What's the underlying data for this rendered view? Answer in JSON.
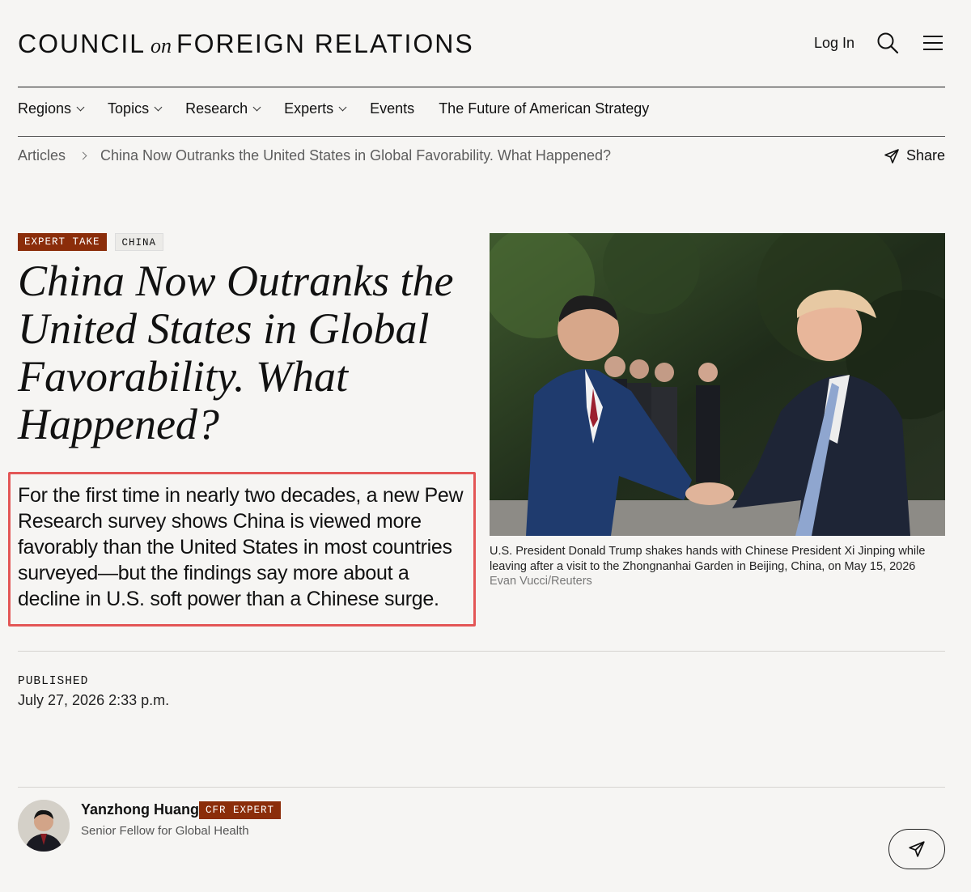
{
  "header": {
    "logo_left": "COUNCIL",
    "logo_on": "on",
    "logo_right": "FOREIGN RELATIONS",
    "login_label": "Log In",
    "search_icon": "search-icon",
    "menu_icon": "hamburger-menu-icon"
  },
  "nav": {
    "items": [
      {
        "label": "Regions",
        "dropdown": true
      },
      {
        "label": "Topics",
        "dropdown": true
      },
      {
        "label": "Research",
        "dropdown": true
      },
      {
        "label": "Experts",
        "dropdown": true
      },
      {
        "label": "Events",
        "dropdown": false
      },
      {
        "label": "The Future of American Strategy",
        "dropdown": false
      }
    ]
  },
  "breadcrumb": {
    "root": "Articles",
    "current": "China Now Outranks the United States in Global Favorability. What Happened?"
  },
  "share_label": "Share",
  "article": {
    "tags": [
      "EXPERT TAKE",
      "CHINA"
    ],
    "title": "China Now Outranks the United States in Global Favorability. What Happened?",
    "summary": "For the first time in nearly two decades, a new Pew Research survey shows China is viewed more favorably than the United States in most countries surveyed—but the findings say more about a decline in U.S. soft power than a Chinese surge.",
    "caption": "U.S. President Donald Trump shakes hands with Chinese President Xi Jinping while leaving after a visit to the Zhongnanhai Garden in Beijing, China, on May 15, 2026",
    "caption_credit": "Evan Vucci/Reuters",
    "published_label": "PUBLISHED",
    "published_date": "July 27, 2026 2:33 p.m."
  },
  "author": {
    "name": "Yanzhong Huang",
    "badge": "CFR EXPERT",
    "role": "Senior Fellow for Global Health"
  },
  "colors": {
    "background": "#f6f5f3",
    "accent": "#8b2d0a",
    "highlight_border": "#e35656"
  }
}
